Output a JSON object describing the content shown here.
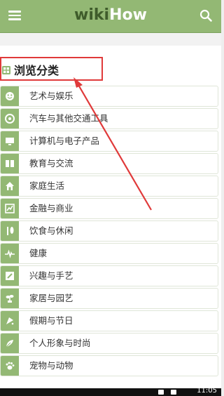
{
  "header": {
    "logo_wiki": "wiki",
    "logo_how": "How",
    "brand_color": "#93b874"
  },
  "section": {
    "title": "浏览分类"
  },
  "categories": [
    {
      "label": "艺术与娱乐",
      "icon": "mask-icon"
    },
    {
      "label": "汽车与其他交通工具",
      "icon": "wheel-icon"
    },
    {
      "label": "计算机与电子产品",
      "icon": "monitor-icon"
    },
    {
      "label": "教育与交流",
      "icon": "book-icon"
    },
    {
      "label": "家庭生活",
      "icon": "home-icon"
    },
    {
      "label": "金融与商业",
      "icon": "chart-icon"
    },
    {
      "label": "饮食与休闲",
      "icon": "food-icon"
    },
    {
      "label": "健康",
      "icon": "heartbeat-icon"
    },
    {
      "label": "兴趣与手艺",
      "icon": "pencil-icon"
    },
    {
      "label": "家居与园艺",
      "icon": "plant-icon"
    },
    {
      "label": "假期与节日",
      "icon": "gift-icon"
    },
    {
      "label": "个人形象与时尚",
      "icon": "feather-icon"
    },
    {
      "label": "宠物与动物",
      "icon": "paw-icon"
    }
  ],
  "status": {
    "time": "11:05"
  }
}
